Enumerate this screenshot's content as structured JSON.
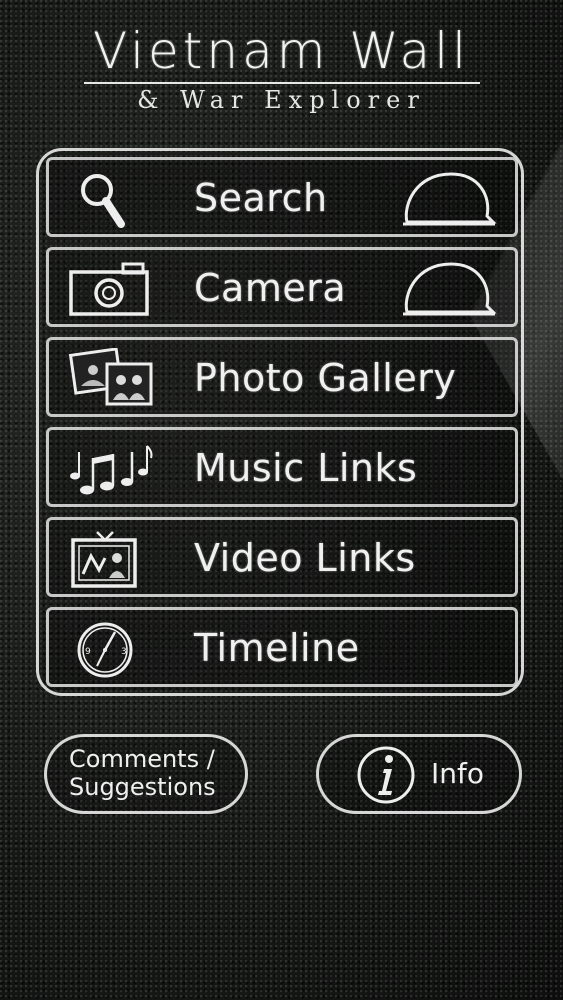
{
  "header": {
    "title": "Vietnam Wall",
    "subtitle": "& War Explorer"
  },
  "menu": {
    "items": [
      {
        "label": "Search",
        "icon": "magnifier-icon",
        "badge": "helmet-icon"
      },
      {
        "label": "Camera",
        "icon": "camera-icon",
        "badge": "helmet-icon"
      },
      {
        "label": "Photo Gallery",
        "icon": "photo-gallery-icon"
      },
      {
        "label": "Music Links",
        "icon": "music-notes-icon"
      },
      {
        "label": "Video Links",
        "icon": "television-icon"
      },
      {
        "label": "Timeline",
        "icon": "clock-icon"
      }
    ]
  },
  "footer": {
    "comments_line1": "Comments /",
    "comments_line2": "Suggestions",
    "info_label": "Info",
    "info_icon": "info-icon"
  },
  "colors": {
    "background": "#141614",
    "outline": "#e8e8e8",
    "text": "#f0f0f0"
  }
}
